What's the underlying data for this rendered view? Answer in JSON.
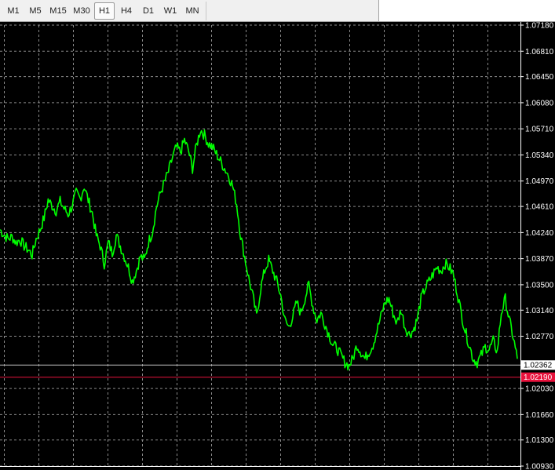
{
  "toolbar": {
    "timeframes": [
      {
        "label": "M1",
        "active": false
      },
      {
        "label": "M5",
        "active": false
      },
      {
        "label": "M15",
        "active": false
      },
      {
        "label": "M30",
        "active": false
      },
      {
        "label": "H1",
        "active": true
      },
      {
        "label": "H4",
        "active": false
      },
      {
        "label": "D1",
        "active": false
      },
      {
        "label": "W1",
        "active": false
      },
      {
        "label": "MN",
        "active": false
      }
    ]
  },
  "colors": {
    "background": "#000000",
    "grid": "#8a8a8a",
    "price_line": "#00ff00",
    "bid_line": "#c0c0c0",
    "ask_line": "#e8123c",
    "axis_text": "#ffffff"
  },
  "price_tags": {
    "bid": "1.02362",
    "ask": "1.02190"
  },
  "chart_data": {
    "type": "line",
    "price_axis_labels": [
      "1.07180",
      "1.06810",
      "1.06450",
      "1.06080",
      "1.05710",
      "1.05340",
      "1.04970",
      "1.04610",
      "1.04240",
      "1.03870",
      "1.03500",
      "1.03140",
      "1.02770",
      "1.02030",
      "1.01660",
      "1.01300",
      "1.00930"
    ],
    "ylim": [
      1.0093,
      1.0718
    ],
    "bid_level": 1.02362,
    "ask_level": 1.0219,
    "series": [
      {
        "values": [
          1.0428,
          1.0421,
          1.0415,
          1.0418,
          1.041,
          1.0414,
          1.0405,
          1.04,
          1.0392,
          1.0415,
          1.0428,
          1.0445,
          1.047,
          1.0462,
          1.0455,
          1.0468,
          1.0458,
          1.045,
          1.0462,
          1.048,
          1.0472,
          1.049,
          1.047,
          1.0452,
          1.042,
          1.0405,
          1.038,
          1.041,
          1.0395,
          1.042,
          1.0405,
          1.039,
          1.0375,
          1.0355,
          1.037,
          1.039,
          1.0385,
          1.041,
          1.0425,
          1.046,
          1.048,
          1.0495,
          1.051,
          1.053,
          1.0545,
          1.0538,
          1.0555,
          1.054,
          1.0515,
          1.0548,
          1.057,
          1.0562,
          1.055,
          1.0545,
          1.0535,
          1.0525,
          1.0515,
          1.0505,
          1.049,
          1.0465,
          1.042,
          1.039,
          1.036,
          1.0335,
          1.0305,
          1.0345,
          1.037,
          1.0385,
          1.037,
          1.0355,
          1.0335,
          1.03,
          1.029,
          1.0305,
          1.0325,
          1.031,
          1.033,
          1.035,
          1.032,
          1.03,
          1.031,
          1.0295,
          1.028,
          1.0265,
          1.026,
          1.025,
          1.024,
          1.0235,
          1.0245,
          1.0265,
          1.0255,
          1.0245,
          1.0255,
          1.0265,
          1.0285,
          1.0305,
          1.0325,
          1.033,
          1.031,
          1.0295,
          1.0315,
          1.029,
          1.028,
          1.0285,
          1.03,
          1.033,
          1.0345,
          1.0355,
          1.0365,
          1.0375,
          1.037,
          1.038,
          1.0375,
          1.0365,
          1.034,
          1.031,
          1.0285,
          1.0265,
          1.0245,
          1.024,
          1.025,
          1.0262,
          1.0258,
          1.027,
          1.0255,
          1.031,
          1.033,
          1.03,
          1.0275,
          1.0245
        ]
      }
    ]
  }
}
